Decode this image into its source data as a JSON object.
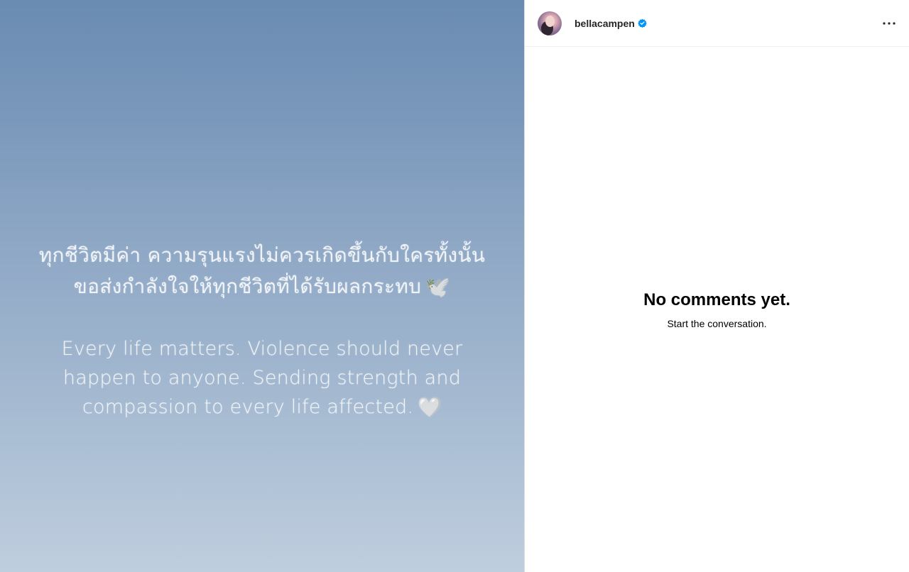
{
  "post": {
    "thai_lines": [
      "ทุกชีวิตมีค่า ความรุนแรงไม่ควรเกิดขึ้นกับใครทั้งนั้น",
      "ขอส่งกำลังใจให้ทุกชีวิตที่ได้รับผลกระทบ"
    ],
    "thai_emoji": "🕊️",
    "english_lines": [
      "Every life matters. Violence should never",
      "happen to anyone. Sending strength and",
      "compassion to every life affected."
    ],
    "english_emoji": "🤍"
  },
  "header": {
    "username": "bellacampen",
    "verified_icon": "verified-badge-icon",
    "more_icon": "more-options-icon"
  },
  "comments": {
    "empty_title": "No comments yet.",
    "empty_subtitle": "Start the conversation."
  },
  "colors": {
    "verified_blue": "#0095f6",
    "gradient_top": "#6a8bb2",
    "gradient_bottom": "#bfcede"
  }
}
